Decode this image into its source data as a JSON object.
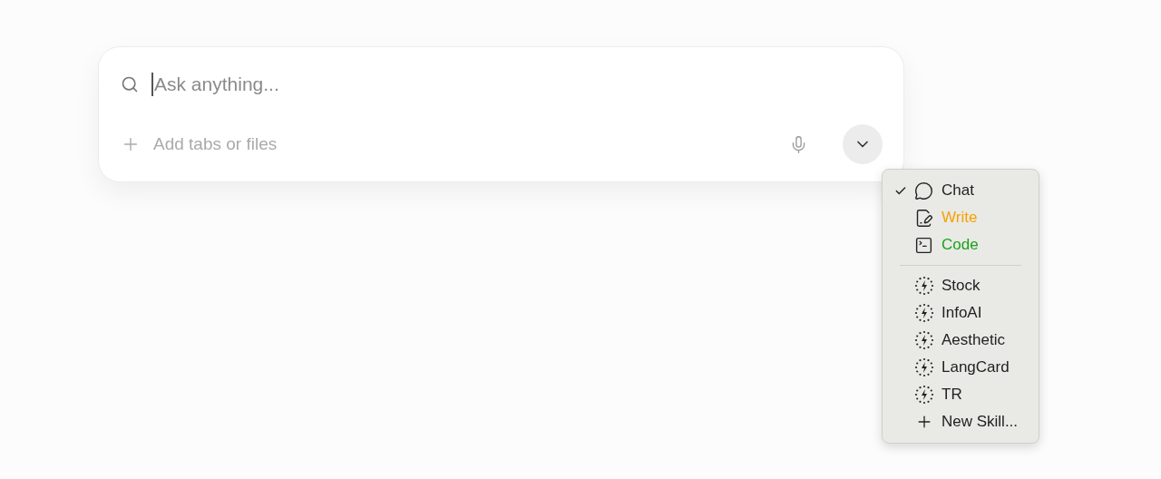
{
  "prompt": {
    "placeholder": "Ask anything...",
    "attach_label": "Add tabs or files"
  },
  "menu": {
    "modes": [
      {
        "kind": "chat",
        "label": "Chat",
        "selected": true,
        "color": "#1f1f1f"
      },
      {
        "kind": "write",
        "label": "Write",
        "selected": false,
        "color": "#f5a300"
      },
      {
        "kind": "code",
        "label": "Code",
        "selected": false,
        "color": "#1aa31a"
      }
    ],
    "skills": [
      "Stock",
      "InfoAI",
      "Aesthetic",
      "LangCard",
      "TR"
    ],
    "new_skill": "New Skill..."
  }
}
